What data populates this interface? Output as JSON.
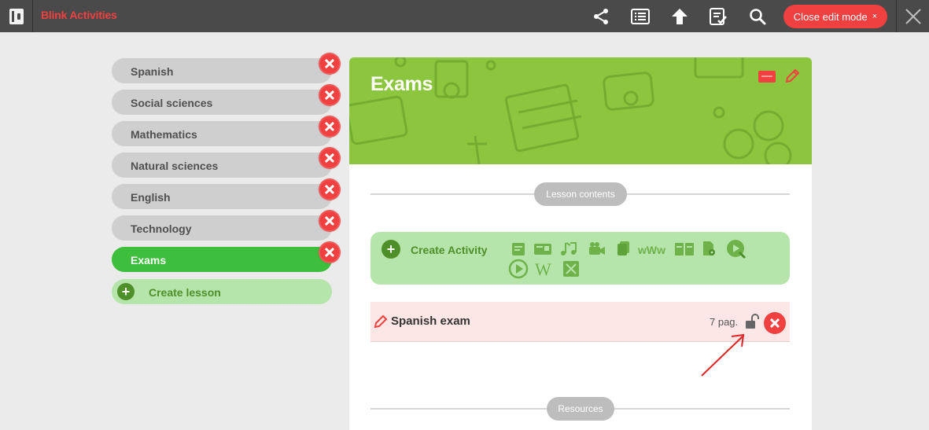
{
  "topbar": {
    "app_title": "Blink Activities",
    "icons": [
      "share-icon",
      "list-icon",
      "upload-arrow-icon",
      "tasks-icon",
      "search-icon"
    ],
    "close_edit_label": "Close edit mode",
    "close_edit_x": "×"
  },
  "sidebar": {
    "lessons": [
      {
        "label": "Spanish",
        "active": false
      },
      {
        "label": "Social sciences",
        "active": false
      },
      {
        "label": "Mathematics",
        "active": false
      },
      {
        "label": "Natural sciences",
        "active": false
      },
      {
        "label": "English",
        "active": false
      },
      {
        "label": "Technology",
        "active": false
      },
      {
        "label": "Exams",
        "active": true
      }
    ],
    "create_lesson_label": "Create lesson",
    "plus": "+"
  },
  "main": {
    "title": "Exams",
    "lesson_contents_label": "Lesson contents",
    "create_activity_label": "Create Activity",
    "plus": "+",
    "activity_icons": [
      "document-icon",
      "presentation-icon",
      "music-icon",
      "video-camera-icon",
      "files-icon",
      "web-link-icon",
      "book-icon",
      "file-settings-icon",
      "interactive-video-icon",
      "play-circle-icon",
      "wikipedia-icon",
      "puzzle-icon"
    ],
    "exam_item": {
      "title": "Spanish exam",
      "pages": "7 pag."
    },
    "resources_label": "Resources"
  },
  "colors": {
    "accent_red": "#f04040",
    "active_green": "#3dbf3d",
    "hero_green": "#8cc63f",
    "light_green": "#b5e5ab",
    "dark_green": "#4f8f2a"
  }
}
